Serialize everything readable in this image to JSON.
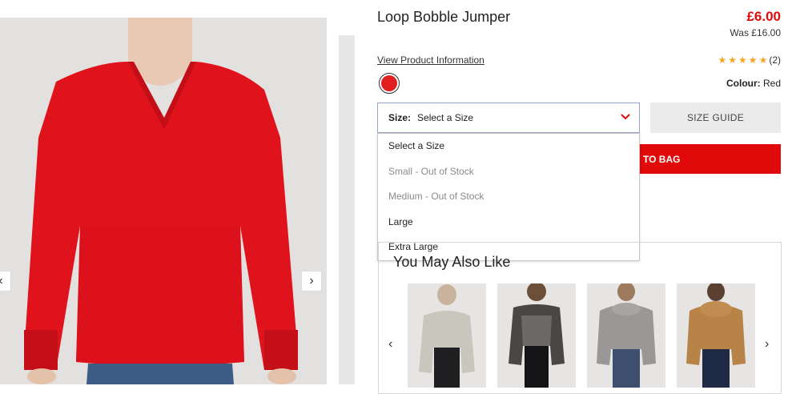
{
  "product": {
    "title": "Loop Bobble Jumper",
    "price": "£6.00",
    "was_price": "Was £16.00",
    "view_info_link": "View Product Information",
    "rating_count": "(2)",
    "colour_label": "Colour:",
    "colour_value": "Red"
  },
  "size_select": {
    "label": "Size:",
    "value": "Select a Size",
    "options": [
      {
        "label": "Select a Size",
        "available": true
      },
      {
        "label": "Small - Out of Stock",
        "available": false
      },
      {
        "label": "Medium - Out of Stock",
        "available": false
      },
      {
        "label": "Large",
        "available": true
      },
      {
        "label": "Extra Large",
        "available": true
      }
    ]
  },
  "buttons": {
    "size_guide": "SIZE GUIDE",
    "add_to_bag": "TO BAG"
  },
  "recommendations": {
    "title": "You May Also Like"
  },
  "gallery": {
    "prev_icon": "‹",
    "next_icon": "›"
  },
  "colors": {
    "accent": "#e10a0a",
    "swatch": "#e02020",
    "star": "#f5a623"
  }
}
